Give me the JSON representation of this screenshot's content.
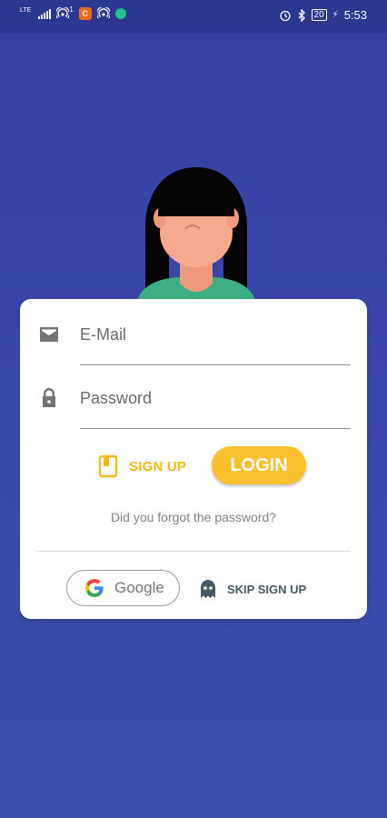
{
  "status_bar": {
    "network": "LTE",
    "sim_badge": "1",
    "battery": "20",
    "time": "5:53"
  },
  "login_form": {
    "email": {
      "placeholder": "E-Mail",
      "value": "",
      "icon": "mail-icon"
    },
    "password": {
      "placeholder": "Password",
      "value": "",
      "icon": "lock-icon"
    },
    "signup_label": "SIGN UP",
    "login_label": "LOGIN",
    "forgot_label": "Did you forgot the password?",
    "google_label": "Google",
    "skip_label": "SKIP SIGN UP"
  },
  "colors": {
    "background": "#3a48a9",
    "accent_yellow": "#fbc02d",
    "card": "#ffffff"
  }
}
